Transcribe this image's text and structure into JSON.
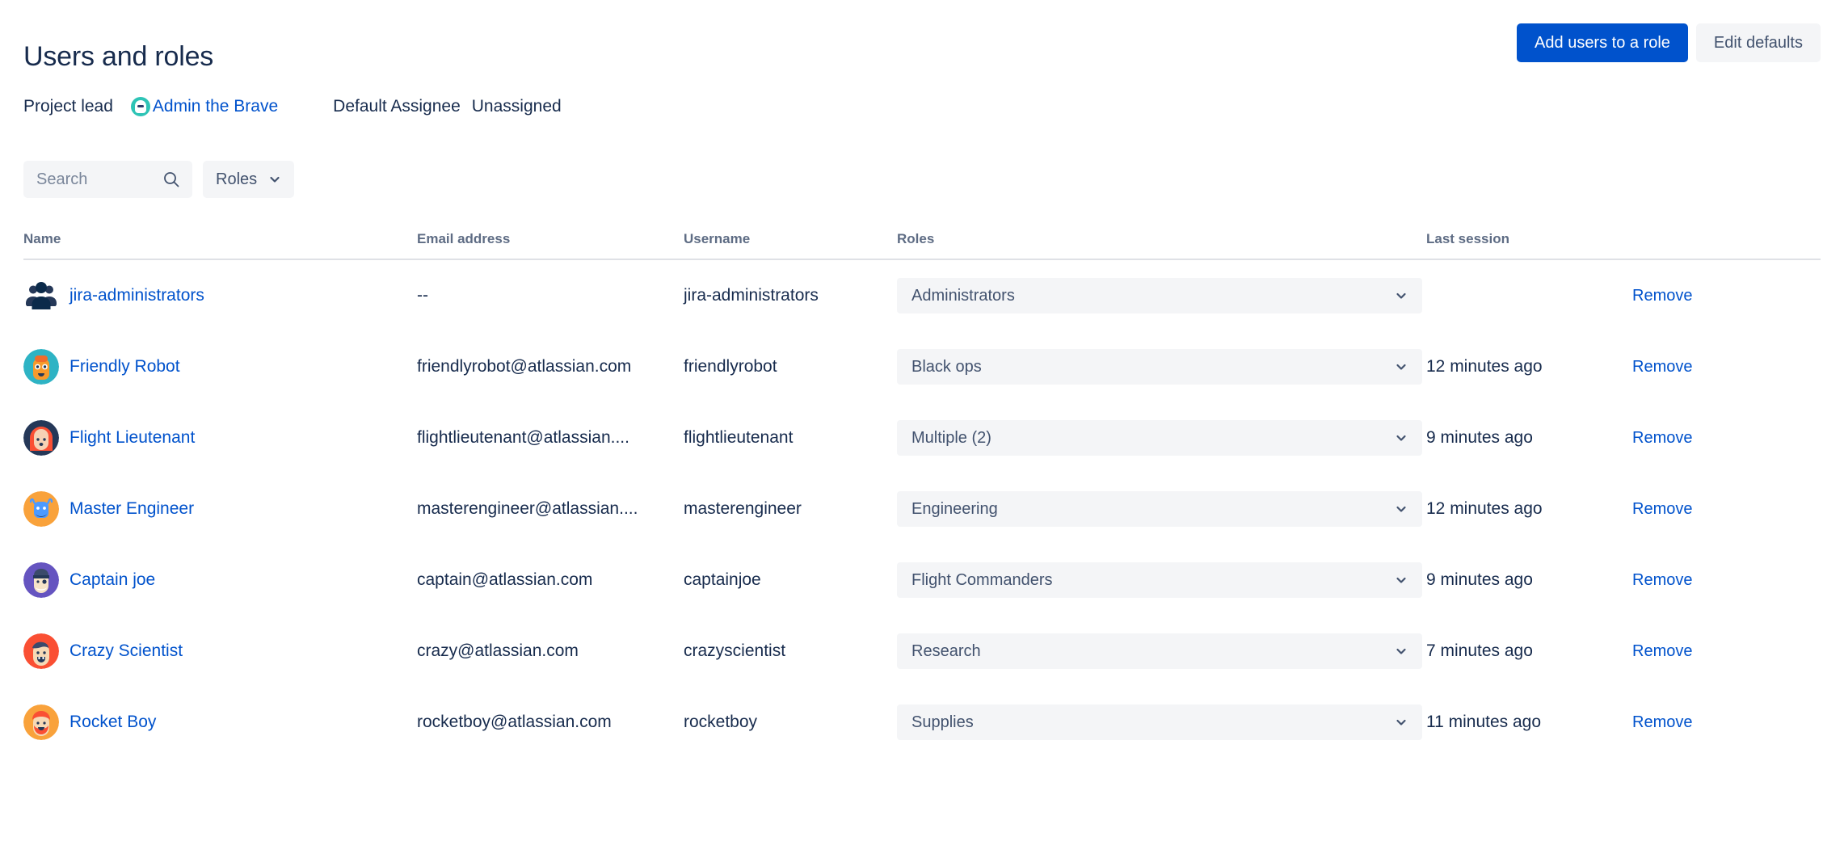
{
  "header": {
    "title": "Users and roles",
    "add_users_button": "Add users to a role",
    "edit_defaults_button": "Edit defaults"
  },
  "meta": {
    "project_lead_label": "Project lead",
    "project_lead_name": "Admin the Brave",
    "default_assignee_label": "Default Assignee",
    "default_assignee_value": "Unassigned"
  },
  "filters": {
    "search_placeholder": "Search",
    "search_value": "",
    "roles_label": "Roles"
  },
  "table": {
    "columns": {
      "name": "Name",
      "email": "Email address",
      "username": "Username",
      "roles": "Roles",
      "last_session": "Last session"
    },
    "rows": [
      {
        "name": "jira-administrators",
        "email": "--",
        "username": "jira-administrators",
        "role": "Administrators",
        "last_session": "",
        "action": "Remove",
        "avatar": "group-icon"
      },
      {
        "name": "Friendly Robot",
        "email": "friendlyrobot@atlassian.com",
        "username": "friendlyrobot",
        "role": "Black ops",
        "last_session": "12 minutes ago",
        "action": "Remove",
        "avatar": "robot-avatar"
      },
      {
        "name": "Flight Lieutenant",
        "email": "flightlieutenant@atlassian....",
        "username": "flightlieutenant",
        "role": "Multiple (2)",
        "last_session": "9 minutes ago",
        "action": "Remove",
        "avatar": "redhair-avatar"
      },
      {
        "name": "Master Engineer",
        "email": "masterengineer@atlassian....",
        "username": "masterengineer",
        "role": "Engineering",
        "last_session": "12 minutes ago",
        "action": "Remove",
        "avatar": "bull-avatar"
      },
      {
        "name": "Captain joe",
        "email": "captain@atlassian.com",
        "username": "captainjoe",
        "role": "Flight Commanders",
        "last_session": "9 minutes ago",
        "action": "Remove",
        "avatar": "captain-avatar"
      },
      {
        "name": "Crazy Scientist",
        "email": "crazy@atlassian.com",
        "username": "crazyscientist",
        "role": "Research",
        "last_session": "7 minutes ago",
        "action": "Remove",
        "avatar": "scientist-avatar"
      },
      {
        "name": "Rocket Boy",
        "email": "rocketboy@atlassian.com",
        "username": "rocketboy",
        "role": "Supplies",
        "last_session": "11 minutes ago",
        "action": "Remove",
        "avatar": "beard-avatar"
      }
    ]
  },
  "colors": {
    "primary": "#0052CC",
    "text": "#172B4D",
    "subtle_text": "#5E6C84",
    "field_bg": "#F4F5F7"
  }
}
